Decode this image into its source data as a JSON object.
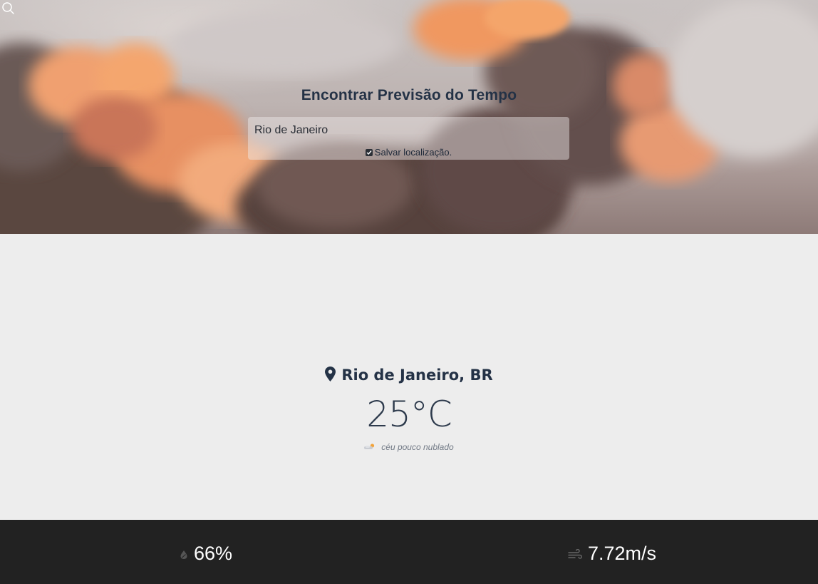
{
  "hero": {
    "title": "Encontrar Previsão do Tempo",
    "search_value": "Rio de Janeiro",
    "save_location_label": "Salvar localização.",
    "save_location_checked": true
  },
  "weather": {
    "location": "Rio de Janeiro, BR",
    "temperature": "25°C",
    "description": "céu pouco nublado",
    "condition_icon": "few-clouds-icon"
  },
  "stats": {
    "humidity": "66%",
    "humidity_icon": "humidity-icon",
    "wind": "7.72m/s",
    "wind_icon": "wind-icon"
  },
  "colors": {
    "title": "#243246",
    "footer_bg": "#222222",
    "main_bg": "#ededed"
  }
}
